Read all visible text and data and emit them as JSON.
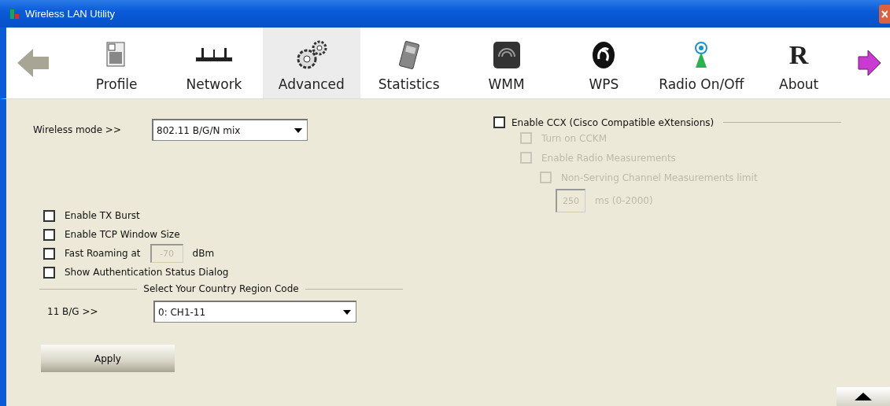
{
  "window": {
    "title": "Wireless LAN Utility"
  },
  "toolbar": {
    "tabs": [
      {
        "label": "Profile",
        "selected": false
      },
      {
        "label": "Network",
        "selected": false
      },
      {
        "label": "Advanced",
        "selected": true
      },
      {
        "label": "Statistics",
        "selected": false
      },
      {
        "label": "WMM",
        "selected": false
      },
      {
        "label": "WPS",
        "selected": false
      },
      {
        "label": "Radio On/Off",
        "selected": false
      },
      {
        "label": "About",
        "selected": false,
        "glyph": "R"
      }
    ]
  },
  "wireless_mode": {
    "label": "Wireless mode >>",
    "value": "802.11 B/G/N mix"
  },
  "options": [
    {
      "kind": "checkbox",
      "label": "Enable TX Burst",
      "checked": false
    },
    {
      "kind": "checkbox",
      "label": "Enable TCP Window Size",
      "checked": false
    },
    {
      "kind": "field",
      "label": "Fast Roaming at",
      "checked": false,
      "value": "-70",
      "unit": "dBm",
      "disabled": true
    },
    {
      "kind": "checkbox",
      "label": "Show Authentication Status Dialog",
      "checked": false
    }
  ],
  "region": {
    "title": "Select Your Country Region Code",
    "label": "11 B/G >>",
    "value": "0: CH1-11"
  },
  "apply": "Apply",
  "ccx": {
    "label": "Enable CCX (Cisco Compatible eXtensions)",
    "checked": false,
    "children": [
      {
        "label": "Turn on CCKM",
        "checked": false,
        "disabled": true
      },
      {
        "label": "Enable Radio Measurements",
        "checked": false,
        "disabled": true,
        "children": [
          {
            "label": "Non-Serving Channel Measurements limit",
            "checked": false,
            "disabled": true,
            "value": "250",
            "unit": "ms (0-2000)"
          }
        ]
      }
    ]
  }
}
